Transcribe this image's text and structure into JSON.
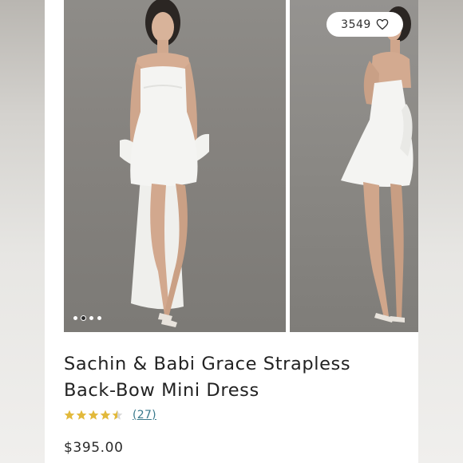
{
  "product": {
    "title": "Sachin & Babi Grace Strapless Back-Bow Mini Dress",
    "like_count": "3549",
    "rating": 4.5,
    "review_count": "(27)",
    "price": "$395.00"
  },
  "gallery": {
    "dots_total": 4,
    "active_dot_index": 1
  },
  "icons": {
    "like": "heart-icon",
    "rating": "star-icon"
  },
  "colors": {
    "star": "#e2b93b",
    "link": "#3a7a8c",
    "photo_backdrop": "#86837f",
    "dress": "#f4f4f2"
  }
}
